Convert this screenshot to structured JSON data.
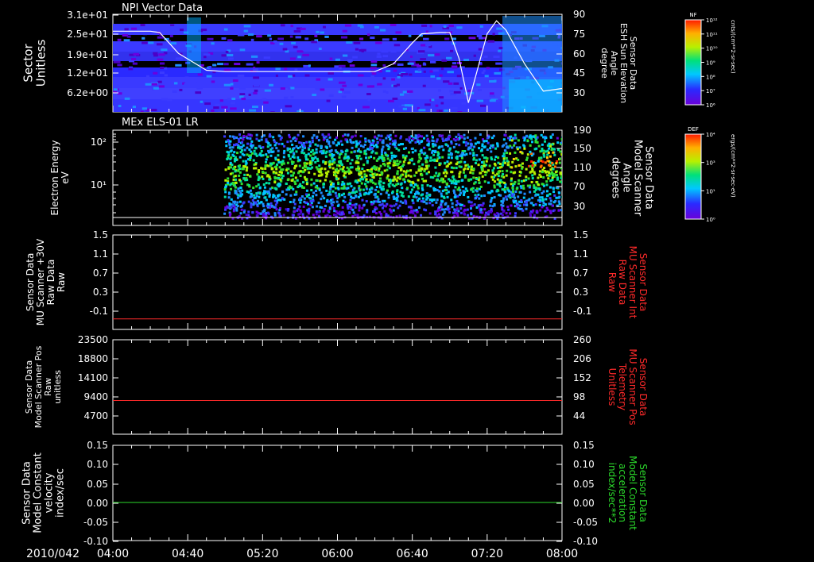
{
  "figure": {
    "date": "2010/042",
    "x_ticks": [
      "04:00",
      "04:40",
      "05:20",
      "06:00",
      "06:40",
      "07:20",
      "08:00"
    ]
  },
  "colors": {
    "white_axis": "#ffffff",
    "red_series": "#ff2a2a",
    "green_series": "#2bd92b",
    "background": "#000000"
  },
  "chart_data": [
    {
      "type": "heatmap",
      "title": "NPI Vector Data",
      "ylabel_left": [
        "Sector",
        "Unitless"
      ],
      "ylabel_right": [
        "Sensor Data",
        "ESH Sun Elevation",
        "Angle",
        "degree"
      ],
      "left_ticks": [
        "3.1e+01",
        "2.5e+01",
        "1.9e+01",
        "1.2e+01",
        "6.2e+00"
      ],
      "right_ticks": [
        "90",
        "75",
        "60",
        "45",
        "30"
      ],
      "right_range": [
        15,
        90
      ],
      "colorbar": {
        "label": "NF",
        "units": "cnts/(cm**2-sr-sec)",
        "ticks": [
          "10¹²",
          "10¹¹",
          "10¹⁰",
          "10⁹",
          "10⁸",
          "10⁷",
          "10⁶"
        ]
      },
      "overlay_line": {
        "name": "ESH Sun Elevation Angle",
        "x": [
          "04:00",
          "04:20",
          "04:25",
          "04:35",
          "04:50",
          "05:00",
          "05:40",
          "06:20",
          "06:30",
          "06:40",
          "06:45",
          "06:55",
          "07:00",
          "07:05",
          "07:10",
          "07:20",
          "07:25",
          "07:30",
          "07:40",
          "07:50",
          "08:00"
        ],
        "y": [
          77,
          77,
          76,
          60,
          47,
          46,
          46,
          46,
          52,
          68,
          75,
          76,
          76,
          56,
          22,
          75,
          85,
          78,
          52,
          31,
          33
        ]
      }
    },
    {
      "type": "heatmap",
      "title": "MEx ELS-01 LR",
      "ylabel_left": [
        "Electron Energy",
        "eV"
      ],
      "ylabel_right": [
        "Sensor Data",
        "Model Scanner",
        "Angle",
        "degrees"
      ],
      "left_ticks": [
        "10²",
        "10¹"
      ],
      "right_ticks": [
        "190",
        "150",
        "110",
        "70",
        "30"
      ],
      "right_range": [
        0,
        190
      ],
      "colorbar": {
        "label": "DEF",
        "units": "ergs/(cm**2-sr-sec-eV)",
        "ticks": [
          "10⁴",
          "10³",
          "10¹",
          "10⁰"
        ]
      }
    },
    {
      "type": "line",
      "ylabel_left": [
        "Sensor Data",
        "MU Scanner +30V",
        "Raw Data",
        "Raw"
      ],
      "ylabel_right": [
        "Sensor Data",
        "MU Scanner Int",
        "Raw Data",
        "Raw"
      ],
      "left_ticks": [
        "1.5",
        "1.1",
        "0.7",
        "0.3",
        "-0.1"
      ],
      "right_ticks": [
        "1.5",
        "1.1",
        "0.7",
        "0.3",
        "-0.1"
      ],
      "ylim": [
        -0.3,
        1.5
      ],
      "series": [
        {
          "x": [
            "04:00",
            "08:00"
          ],
          "y": [
            -0.1,
            -0.1
          ],
          "color": "red"
        }
      ]
    },
    {
      "type": "line",
      "ylabel_left": [
        "Sensor Data",
        "Model Scanner Pos",
        "Raw",
        "unitless"
      ],
      "ylabel_right": [
        "Sensor Data",
        "MU Scanner Pos",
        "Telemetry",
        "Unitless"
      ],
      "left_ticks": [
        "23500",
        "18800",
        "14100",
        "9400",
        "4700"
      ],
      "right_ticks": [
        "260",
        "206",
        "152",
        "98",
        "44"
      ],
      "ylim": [
        0,
        23500
      ],
      "series": [
        {
          "x": [
            "04:00",
            "08:00"
          ],
          "y": [
            8400,
            8400
          ],
          "color": "red"
        }
      ]
    },
    {
      "type": "line",
      "ylabel_left": [
        "Sensor Data",
        "Model Constant",
        "velocity",
        "index/sec"
      ],
      "ylabel_right": [
        "Sensor Data",
        "Model Constant",
        "acceleration",
        "index/sec**2"
      ],
      "left_ticks": [
        "0.15",
        "0.10",
        "0.05",
        "0.00",
        "-0.05",
        "-0.10"
      ],
      "right_ticks": [
        "0.15",
        "0.10",
        "0.05",
        "0.00",
        "-0.05",
        "-0.10"
      ],
      "ylim": [
        -0.1,
        0.15
      ],
      "series": [
        {
          "x": [
            "04:00",
            "08:00"
          ],
          "y": [
            0,
            0
          ],
          "color": "green"
        }
      ]
    }
  ]
}
